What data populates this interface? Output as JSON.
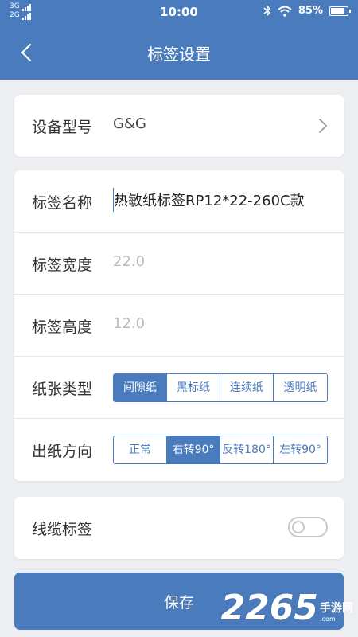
{
  "status_bar": {
    "network_1": "3G",
    "network_2": "2G",
    "time": "10:00",
    "battery": "85%",
    "battery_level": 0.85
  },
  "nav": {
    "title": "标签设置"
  },
  "device": {
    "label": "设备型号",
    "value": "G&G"
  },
  "label_settings": {
    "name_label": "标签名称",
    "name_value": "热敏纸标签RP12*22-260C款",
    "width_label": "标签宽度",
    "width_placeholder": "22.0",
    "height_label": "标签高度",
    "height_placeholder": "12.0",
    "paper_type_label": "纸张类型",
    "paper_type_options": [
      "间隙纸",
      "黑标纸",
      "连续纸",
      "透明纸"
    ],
    "paper_type_selected": "间隙纸",
    "direction_label": "出纸方向",
    "direction_options": [
      "正常",
      "右转90°",
      "反转180°",
      "左转90°"
    ],
    "direction_selected": "右转90°"
  },
  "cable": {
    "label": "线缆标签",
    "enabled": false
  },
  "save_label": "保存",
  "watermark": {
    "number": "2265",
    "cn": "手游网",
    "en": ".com"
  },
  "colors": {
    "primary": "#4a7bbc",
    "background": "#eceef1",
    "placeholder": "#b9bcc0"
  }
}
